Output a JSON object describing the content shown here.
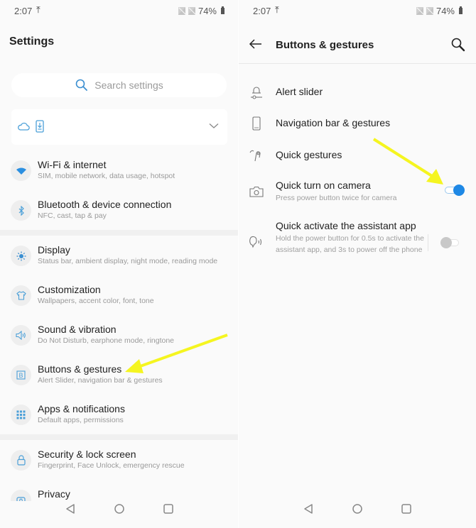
{
  "status_bar": {
    "time": "2:07",
    "upload_icon": "upload-arrow-icon",
    "battery": "74%"
  },
  "left": {
    "title": "Settings",
    "search": {
      "placeholder": "Search settings",
      "icon": "search-icon"
    },
    "card": {
      "icons": [
        "cloud-icon",
        "phone-download-icon"
      ],
      "expand_icon": "chevron-down-icon"
    },
    "items": [
      {
        "title": "Wi-Fi & internet",
        "subtitle": "SIM, mobile network, data usage, hotspot",
        "icon": "wifi-icon"
      },
      {
        "title": "Bluetooth & device connection",
        "subtitle": "NFC, cast, tap & pay",
        "icon": "bluetooth-icon"
      },
      {
        "title": "Display",
        "subtitle": "Status bar, ambient display, night mode, reading mode",
        "icon": "brightness-icon"
      },
      {
        "title": "Customization",
        "subtitle": "Wallpapers, accent color, font, tone",
        "icon": "tshirt-icon"
      },
      {
        "title": "Sound & vibration",
        "subtitle": "Do Not Disturb, earphone mode, ringtone",
        "icon": "speaker-icon"
      },
      {
        "title": "Buttons & gestures",
        "subtitle": "Alert Slider, navigation bar & gestures",
        "icon": "buttons-icon"
      },
      {
        "title": "Apps & notifications",
        "subtitle": "Default apps, permissions",
        "icon": "apps-grid-icon"
      },
      {
        "title": "Security & lock screen",
        "subtitle": "Fingerprint, Face Unlock, emergency rescue",
        "icon": "lock-icon"
      },
      {
        "title": "Privacy",
        "subtitle": "",
        "icon": "privacy-icon"
      }
    ]
  },
  "right": {
    "title": "Buttons & gestures",
    "items": [
      {
        "title": "Alert slider",
        "subtitle": "",
        "icon": "alert-slider-icon"
      },
      {
        "title": "Navigation bar & gestures",
        "subtitle": "",
        "icon": "phone-outline-icon"
      },
      {
        "title": "Quick gestures",
        "subtitle": "",
        "icon": "gesture-icon"
      },
      {
        "title": "Quick turn on camera",
        "subtitle": "Press power button twice for camera",
        "icon": "camera-icon",
        "toggle": true
      },
      {
        "title": "Quick activate the assistant app",
        "subtitle": "Hold the power button for 0.5s to activate the assistant app, and 3s to power off the phone",
        "icon": "assistant-icon",
        "toggle": false
      }
    ]
  },
  "nav_bar": {
    "back": "back-triangle-icon",
    "home": "home-circle-icon",
    "recents": "recents-square-icon"
  },
  "colors": {
    "accent": "#1e88e5",
    "icon_blue": "#4a9fd8",
    "annotation_arrow": "#f5f520"
  }
}
